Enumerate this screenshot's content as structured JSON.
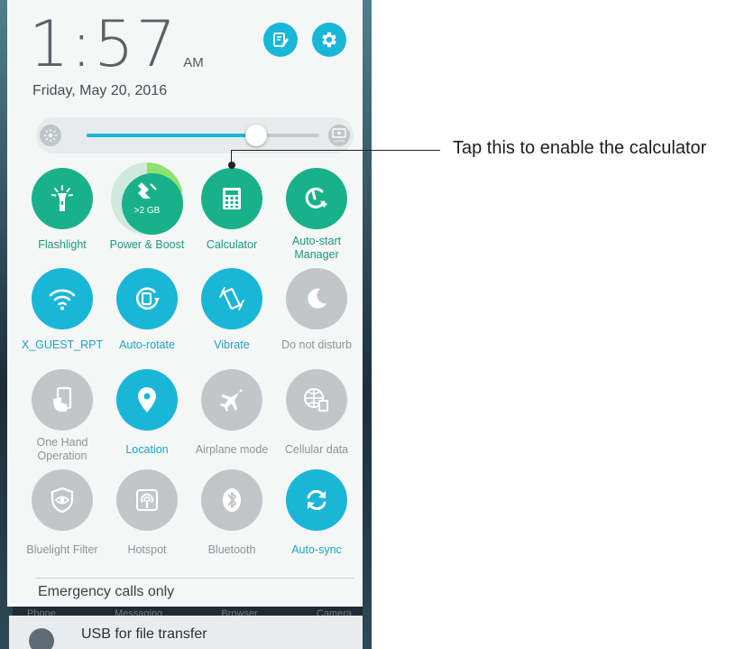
{
  "status": {
    "time": "1:57",
    "ampm": "AM",
    "date": "Friday, May 20, 2016"
  },
  "brightness": {
    "level": 0.73,
    "auto_label": "AUTO"
  },
  "tiles": [
    {
      "label": "Flashlight",
      "icon": "flashlight-icon",
      "state": "on"
    },
    {
      "label": "Power & Boost",
      "icon": "power-boost-icon",
      "state": "on",
      "sub": ">2 GB"
    },
    {
      "label": "Calculator",
      "icon": "calculator-icon",
      "state": "on"
    },
    {
      "label": "Auto-start Manager",
      "icon": "auto-start-icon",
      "state": "on"
    },
    {
      "label": "X_GUEST_RPT",
      "icon": "wifi-icon",
      "state": "on"
    },
    {
      "label": "Auto-rotate",
      "icon": "auto-rotate-icon",
      "state": "on"
    },
    {
      "label": "Vibrate",
      "icon": "vibrate-icon",
      "state": "on"
    },
    {
      "label": "Do not disturb",
      "icon": "moon-icon",
      "state": "off"
    },
    {
      "label": "One Hand Operation",
      "icon": "one-hand-icon",
      "state": "off"
    },
    {
      "label": "Location",
      "icon": "location-icon",
      "state": "on"
    },
    {
      "label": "Airplane mode",
      "icon": "airplane-icon",
      "state": "off"
    },
    {
      "label": "Cellular data",
      "icon": "cellular-data-icon",
      "state": "off"
    },
    {
      "label": "Bluelight Filter",
      "icon": "bluelight-filter-icon",
      "state": "off"
    },
    {
      "label": "Hotspot",
      "icon": "hotspot-icon",
      "state": "off"
    },
    {
      "label": "Bluetooth",
      "icon": "bluetooth-icon",
      "state": "off"
    },
    {
      "label": "Auto-sync",
      "icon": "sync-icon",
      "state": "on"
    }
  ],
  "network": {
    "status": "Emergency calls only"
  },
  "dock_apps": [
    "Phone",
    "Messaging",
    "Browser",
    "Camera"
  ],
  "notification": {
    "title": "USB for file transfer"
  },
  "callout": {
    "text": "Tap this to enable the calculator"
  },
  "colors": {
    "green": "#19b18a",
    "blue": "#1ab6d8",
    "gray": "#c3c6c8"
  }
}
